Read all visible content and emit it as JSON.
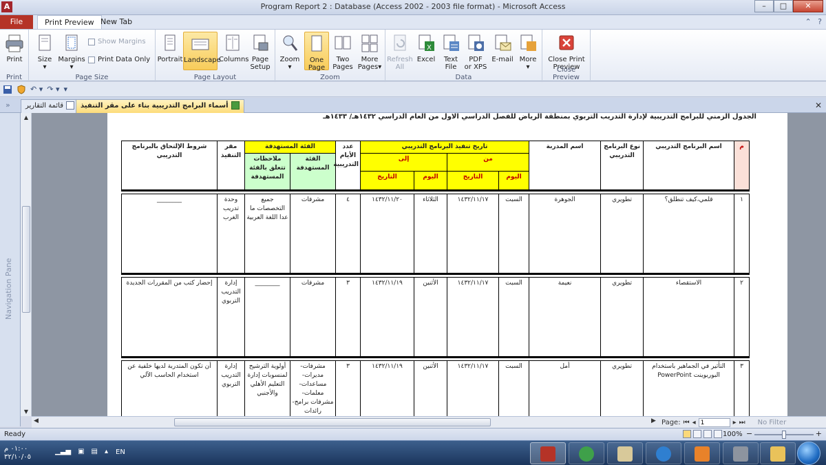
{
  "window": {
    "title": "Program Report 2 : Database (Access 2002 - 2003 file format)  -  Microsoft Access",
    "app_letter": "A"
  },
  "ribbon_tabs": {
    "file": "File",
    "print_preview": "Print Preview",
    "new_tab": "New Tab"
  },
  "ribbon": {
    "print": {
      "label": "Print",
      "group": "Print"
    },
    "size": "Size",
    "margins": "Margins",
    "show_margins": "Show Margins",
    "print_data_only": "Print Data Only",
    "page_size_group": "Page Size",
    "portrait": "Portrait",
    "landscape": "Landscape",
    "columns": "Columns",
    "page_setup_1": "Page",
    "page_setup_2": "Setup",
    "page_layout_group": "Page Layout",
    "zoom": "Zoom",
    "one_page_1": "One",
    "one_page_2": "Page",
    "two_pages_1": "Two",
    "two_pages_2": "Pages",
    "more_pages_1": "More",
    "more_pages_2": "Pages",
    "zoom_group": "Zoom",
    "refresh_all_1": "Refresh",
    "refresh_all_2": "All",
    "excel": "Excel",
    "text_file_1": "Text",
    "text_file_2": "File",
    "pdf_1": "PDF",
    "pdf_2": "or XPS",
    "email": "E-mail",
    "more": "More",
    "data_group": "Data",
    "close_preview_1": "Close Print",
    "close_preview_2": "Preview",
    "close_preview_group": "Close Preview"
  },
  "doc_tabs": {
    "tab1": "أسماء البرامج التدريبية بناء على مقر التنفيذ",
    "tab2": "قائمة التقارير"
  },
  "navpane": {
    "label": "Navigation Pane"
  },
  "report": {
    "title": "الجدول الزمني للبرامج التدريبية لإدارة التدريب التربوي بمنطقة الرياض للفصل الدراسي الاول من العام الدراسي ١٤٣٢هـ/ ١٤٣٣هـ",
    "headers": {
      "num": "م",
      "program_name": "اسم البرنامج التدريبي",
      "program_type": "نوع البرنامج التدريبي",
      "trainer": "اسم المدربة",
      "schedule": "تاريخ تنفيذ البرنامج التدريبي",
      "from": "من",
      "to": "إلى",
      "day": "اليوم",
      "date": "التاريخ",
      "days_count": "عدد الأيام التدريبية",
      "target_group": "الفئة المستهدفة",
      "target_group_sub": "الفئة المستهدفة",
      "target_notes": "ملاحظات تتعلق بالفئة المستهدفة",
      "venue": "مقر التنفيذ",
      "conditions": "شروط الإلتحاق بالبرنامج التدريبي"
    },
    "rows": [
      {
        "num": "١",
        "program_name": "قلمي،كيف تنطلق؟",
        "program_type": "تطويري",
        "trainer": "الجوهرة",
        "from_day": "السبت",
        "from_date": "١٤٣٢/١١/١٧",
        "to_day": "الثلاثاء",
        "to_date": "١٤٣٢/١١/٢٠",
        "days_count": "٤",
        "target_group": "مشرفات",
        "target_notes": "جميع التخصصات ما عدا اللغة العربية",
        "venue": "وحدة تدريب الغرب",
        "conditions": "________"
      },
      {
        "num": "٢",
        "program_name": "الاستقصاء",
        "program_type": "تطويري",
        "trainer": "نعيمة",
        "from_day": "السبت",
        "from_date": "١٤٣٢/١١/١٧",
        "to_day": "الأثنين",
        "to_date": "١٤٣٢/١١/١٩",
        "days_count": "٣",
        "target_group": "مشرفات",
        "target_notes": "________",
        "venue": "إدارة التدريب التربوي",
        "conditions": "إحضار كتب من المقررات الجديدة"
      },
      {
        "num": "٣",
        "program_name": "التأثير في الجماهير باستخدام البوربوينت PowerPoint",
        "program_type": "تطويري",
        "trainer": "أمل",
        "from_day": "السبت",
        "from_date": "١٤٣٢/١١/١٧",
        "to_day": "الأثنين",
        "to_date": "١٤٣٢/١١/١٩",
        "days_count": "٣",
        "target_group": "مشرفات-مديرات-مساعدات-معلمات-مشرفات برامج-رائدات",
        "target_notes": "أولوية الترشيح لمنسوبات إدارة التعليم الأهلي والأجنبي",
        "venue": "إدارة التدريب التربوي",
        "conditions": "أن تكون المتدربة لديها خلفية عن استخدام الحاسب الآلي"
      }
    ]
  },
  "pager": {
    "label": "Page:",
    "value": "1",
    "filter": "No Filter"
  },
  "status": {
    "text": "Ready",
    "zoom": "100%"
  },
  "taskbar": {
    "time": "٠١:٠٠ م",
    "date": "٣٢/١٠/٠٥",
    "lang": "EN"
  },
  "colors": {
    "file_tab": "#b53327",
    "yellow_header": "#ffff00",
    "green_header": "#ccffcc",
    "pink_header": "#fbe0d8",
    "red_text": "#c00000"
  }
}
